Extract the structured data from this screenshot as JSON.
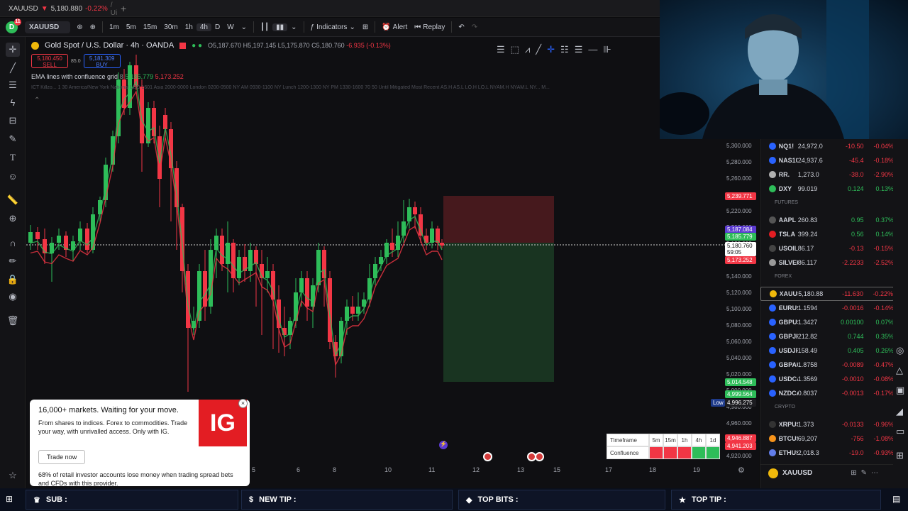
{
  "browser": {
    "tab_title": "XAUUSD",
    "tab_price": "5,180.880",
    "tab_change": "-0.22%",
    "tab_suffix": "/ Ui"
  },
  "toolbar": {
    "avatar_letter": "D",
    "notif_count": "11",
    "symbol": "XAUUSD",
    "timeframes": [
      "1m",
      "5m",
      "15m",
      "30m",
      "1h",
      "4h",
      "D",
      "W"
    ],
    "active_tf": "4h",
    "indicators": "Indicators",
    "alert": "Alert",
    "replay": "Replay"
  },
  "legend": {
    "title": "Gold Spot / U.S. Dollar · 4h · OANDA",
    "ohlc": "O5,187.670 H5,197.145 L5,175.870 C5,180.760",
    "change": "-6.935 (-0.13%)"
  },
  "trade": {
    "sell_price": "5,180.450",
    "sell_label": "SELL",
    "spread": "85.0",
    "buy_price": "5,181.309",
    "buy_label": "BUY"
  },
  "indicator1": {
    "name": "EMA lines with confluence grid",
    "v1": "8",
    "v2": "5,185.779",
    "v3": "5,173.252"
  },
  "indicator2": "ICT Killzo... 1 30 America/New York  National  LBO 1601 Asia 2000-0000 London 0200-0500 NY AM 0930-1100 NY Lunch 1200-1300 NY PM 1330-1600 70 50 Until Mitigated Most Recent AS.H AS.L LO.H LO.L NYAM.H NYAM.L NY... M...",
  "price_scale": [
    "5,300.000",
    "5,280.000",
    "5,260.000",
    "5,240.000",
    "5,220.000",
    "5,200.000",
    "5,180.000",
    "5,160.000",
    "5,140.000",
    "5,120.000",
    "5,100.000",
    "5,080.000",
    "5,060.000",
    "5,040.000",
    "5,020.000",
    "5,000.000",
    "4,980.000",
    "4,960.000",
    "4,940.000",
    "4,920.000"
  ],
  "price_badges": {
    "stop": "5,239.771",
    "b1": "5,187.084",
    "b2": "5,185.779",
    "cur": "5,180.760",
    "timer": "59:05",
    "b3": "5,173.252",
    "target": "5,014.548",
    "b4": "4,999.564",
    "low_label": "Low",
    "low": "4,996.275",
    "b5": "4,946.887",
    "b6": "4,941.203"
  },
  "date_scale": [
    "5",
    "6",
    "8",
    "10",
    "11",
    "12",
    "13",
    "15",
    "17",
    "18",
    "19"
  ],
  "ad": {
    "headline": "16,000+ markets. Waiting for your move.",
    "body": "From shares to indices. Forex to commodities. Trade your way, with unrivalled access. Only with IG.",
    "button": "Trade now",
    "warning": "68% of retail investor accounts lose money when trading spread bets and CFDs with this provider.",
    "logo": "IG"
  },
  "confluence": {
    "tf_label": "Timeframe",
    "tfs": [
      "5m",
      "15m",
      "1h",
      "4h",
      "1d"
    ],
    "row_label": "Confluence",
    "cells": [
      "#f23645",
      "#f23645",
      "#f23645",
      "#2ebd59",
      "#2ebd59"
    ]
  },
  "watchlist": {
    "rows": [
      {
        "sym": "NQ1!",
        "last": "24,972.0",
        "chg": "-10.50",
        "pct": "-0.04%",
        "dir": "neg",
        "icon": "#2962ff"
      },
      {
        "sym": "NAS100",
        "last": "24,937.6",
        "chg": "-45.4",
        "pct": "-0.18%",
        "dir": "neg",
        "icon": "#2962ff"
      },
      {
        "sym": "RR.",
        "last": "1,273.0",
        "chg": "-38.0",
        "pct": "-2.90%",
        "dir": "neg",
        "icon": "#b0b0b0"
      },
      {
        "sym": "DXY",
        "last": "99.019",
        "chg": "0.124",
        "pct": "0.13%",
        "dir": "pos",
        "icon": "#2ebd59"
      }
    ],
    "futures_label": "FUTURES",
    "futures": [
      {
        "sym": "AAPL",
        "last": "260.83",
        "chg": "0.95",
        "pct": "0.37%",
        "dir": "pos",
        "icon": "#555"
      },
      {
        "sym": "TSLA",
        "last": "399.24",
        "chg": "0.56",
        "pct": "0.14%",
        "dir": "pos",
        "icon": "#e31d23"
      },
      {
        "sym": "USOIL",
        "last": "86.17",
        "chg": "-0.13",
        "pct": "-0.15%",
        "dir": "neg",
        "icon": "#444"
      },
      {
        "sym": "SILVER",
        "last": "86.117",
        "chg": "-2.2233",
        "pct": "-2.52%",
        "dir": "neg",
        "icon": "#999"
      }
    ],
    "forex_label": "FOREX",
    "forex": [
      {
        "sym": "XAUUSD",
        "last": "5,180.88",
        "chg": "-11.630",
        "pct": "-0.22%",
        "dir": "neg",
        "icon": "#f0b90b"
      },
      {
        "sym": "EURUSD",
        "last": "1.1594",
        "chg": "-0.0016",
        "pct": "-0.14%",
        "dir": "neg",
        "icon": "#2962ff"
      },
      {
        "sym": "GBPUSD",
        "last": "1.3427",
        "chg": "0.00100",
        "pct": "0.07%",
        "dir": "pos",
        "icon": "#2962ff"
      },
      {
        "sym": "GBPJPY",
        "last": "212.82",
        "chg": "0.744",
        "pct": "0.35%",
        "dir": "pos",
        "icon": "#2962ff"
      },
      {
        "sym": "USDJPY",
        "last": "158.49",
        "chg": "0.405",
        "pct": "0.26%",
        "dir": "pos",
        "icon": "#2962ff"
      },
      {
        "sym": "GBPAUD",
        "last": "1.8758",
        "chg": "-0.0089",
        "pct": "-0.47%",
        "dir": "neg",
        "icon": "#2962ff"
      },
      {
        "sym": "USDCAD",
        "last": "1.3569",
        "chg": "-0.0010",
        "pct": "-0.08%",
        "dir": "neg",
        "icon": "#2962ff"
      },
      {
        "sym": "NZDCAD",
        "last": "0.8037",
        "chg": "-0.0013",
        "pct": "-0.17%",
        "dir": "neg",
        "icon": "#2962ff"
      }
    ],
    "crypto_label": "CRYPTO",
    "crypto": [
      {
        "sym": "XRPUSD",
        "last": "1.373",
        "chg": "-0.0133",
        "pct": "-0.96%",
        "dir": "neg",
        "icon": "#333"
      },
      {
        "sym": "BTCUSD",
        "last": "69,207",
        "chg": "-756",
        "pct": "-1.08%",
        "dir": "neg",
        "icon": "#f7931a"
      },
      {
        "sym": "ETHUSD",
        "last": "2,018.3",
        "chg": "-19.0",
        "pct": "-0.93%",
        "dir": "neg",
        "icon": "#627eea"
      }
    ],
    "footer_symbol": "XAUUSD"
  },
  "overlay": {
    "sub": "SUB :",
    "new_tip": "NEW TIP :",
    "top_bits": "TOP BITS :",
    "top_tip": "TOP TIP :"
  },
  "colors": {
    "up": "#2ebd59",
    "down": "#f23645",
    "bg": "#0f0f12"
  }
}
